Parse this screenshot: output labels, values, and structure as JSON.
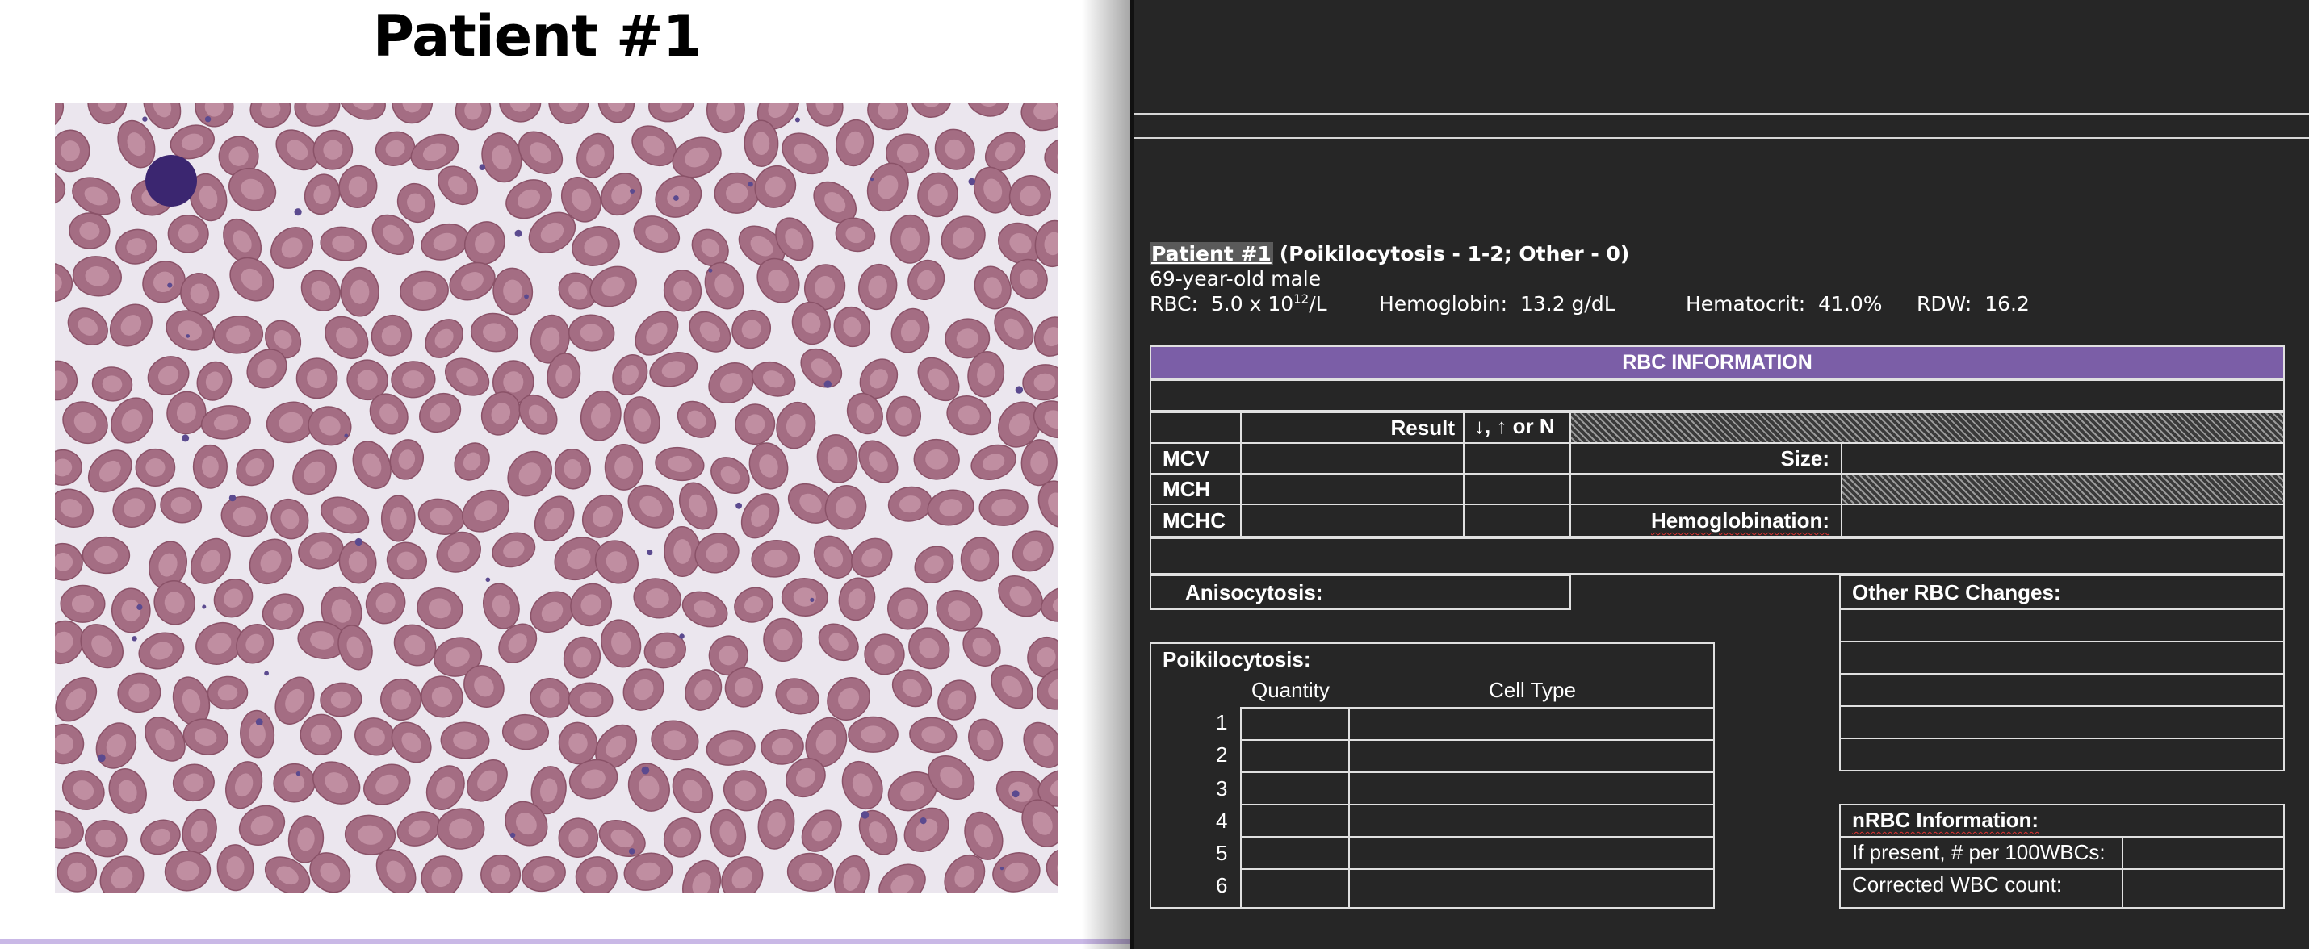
{
  "slide": {
    "title": "Patient #1"
  },
  "doc": {
    "patient_link": "Patient #1",
    "patient_grading": "(Poikilocytosis - 1-2; Other - 0)",
    "patient_desc": "69-year-old male",
    "rbc_label": "RBC:",
    "rbc_value": "5.0 x 10",
    "rbc_exp": "12",
    "rbc_unit": "/L",
    "hgb_label": "Hemoglobin:",
    "hgb_value": "13.2 g/dL",
    "hct_label": "Hematocrit:",
    "hct_value": "41.0%",
    "rdw_label": "RDW:",
    "rdw_value": "16.2"
  },
  "rbc_table": {
    "header": "RBC INFORMATION",
    "col_result": "Result",
    "col_direction": "↓, ↑ or N",
    "rows": [
      "MCV",
      "MCH",
      "MCHC"
    ],
    "size_label": "Size:",
    "hemoglobination_label": "Hemoglobination:",
    "anisocytosis_label": "Anisocytosis:",
    "other_changes_label": "Other RBC Changes:",
    "poikilocytosis_label": "Poikilocytosis:",
    "quantity_label": "Quantity",
    "cell_type_label": "Cell Type",
    "poik_rows": [
      "1",
      "2",
      "3",
      "4",
      "5",
      "6"
    ],
    "nrbc_label": "nRBC Information:",
    "nrbc_per_100": "If present, # per 100WBCs:",
    "corrected_wbc": "Corrected WBC count:"
  },
  "colors": {
    "header_purple": "#7b5ea7",
    "doc_background": "#262626",
    "rbc_fill": "#a46d83",
    "lymphocyte": "#3b2670"
  }
}
